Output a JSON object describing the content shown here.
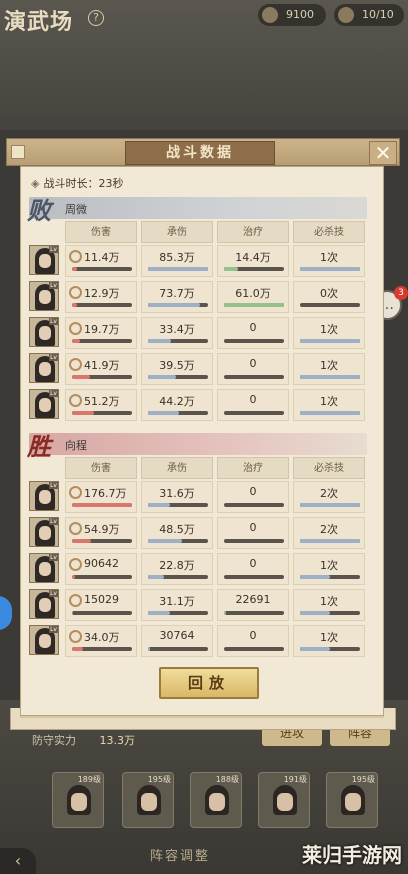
{
  "scene": {
    "title": "演武场",
    "help_icon": "?",
    "resources": [
      {
        "icon": "coin-icon",
        "value": "9100"
      },
      {
        "icon": "stamina-icon",
        "value": "10/10"
      }
    ],
    "power_label": "防守实力",
    "power_value": "13.3万",
    "defense_button": "进攻",
    "other_button": "阵容",
    "formation_label": "阵容调整",
    "heroes": [
      {
        "level": "189级"
      },
      {
        "level": "195级"
      },
      {
        "level": "188级"
      },
      {
        "level": "191级"
      },
      {
        "level": "195级"
      }
    ],
    "chat_badge": "3",
    "watermark": "莱归手游网"
  },
  "modal": {
    "title": "战斗数据",
    "close_label": "✕",
    "duration": "战斗时长：23秒",
    "columns": [
      "伤害",
      "承伤",
      "治疗",
      "必杀技"
    ],
    "teams": [
      {
        "result": "败",
        "name": "周微",
        "rows": [
          {
            "damage": "11.4万",
            "taken": "85.3万",
            "heal": "14.4万",
            "ult": "1次",
            "bars": [
              0.08,
              1.0,
              0.24,
              1.0
            ]
          },
          {
            "damage": "12.9万",
            "taken": "73.7万",
            "heal": "61.0万",
            "ult": "0次",
            "bars": [
              0.09,
              0.86,
              1.0,
              0.0
            ]
          },
          {
            "damage": "19.7万",
            "taken": "33.4万",
            "heal": "0",
            "ult": "1次",
            "bars": [
              0.14,
              0.39,
              0.0,
              1.0
            ]
          },
          {
            "damage": "41.9万",
            "taken": "39.5万",
            "heal": "0",
            "ult": "1次",
            "bars": [
              0.3,
              0.46,
              0.0,
              1.0
            ]
          },
          {
            "damage": "51.2万",
            "taken": "44.2万",
            "heal": "0",
            "ult": "1次",
            "bars": [
              0.37,
              0.52,
              0.0,
              1.0
            ]
          }
        ]
      },
      {
        "result": "胜",
        "name": "向程",
        "rows": [
          {
            "damage": "176.7万",
            "taken": "31.6万",
            "heal": "0",
            "ult": "2次",
            "bars": [
              1.0,
              0.37,
              0.0,
              1.0
            ]
          },
          {
            "damage": "54.9万",
            "taken": "48.5万",
            "heal": "0",
            "ult": "2次",
            "bars": [
              0.31,
              0.57,
              0.0,
              1.0
            ]
          },
          {
            "damage": "90642",
            "taken": "22.8万",
            "heal": "0",
            "ult": "1次",
            "bars": [
              0.05,
              0.27,
              0.0,
              0.5
            ]
          },
          {
            "damage": "15029",
            "taken": "31.1万",
            "heal": "22691",
            "ult": "1次",
            "bars": [
              0.01,
              0.36,
              0.04,
              0.5
            ]
          },
          {
            "damage": "34.0万",
            "taken": "30764",
            "heal": "0",
            "ult": "1次",
            "bars": [
              0.19,
              0.04,
              0.0,
              0.5
            ]
          }
        ]
      }
    ],
    "replay_label": "回放"
  },
  "colors": {
    "damage_bar": "#d9776c",
    "taken_bar": "#9db0c6",
    "heal_bar": "#94c28c",
    "ult_bar": "#9db0c6"
  }
}
